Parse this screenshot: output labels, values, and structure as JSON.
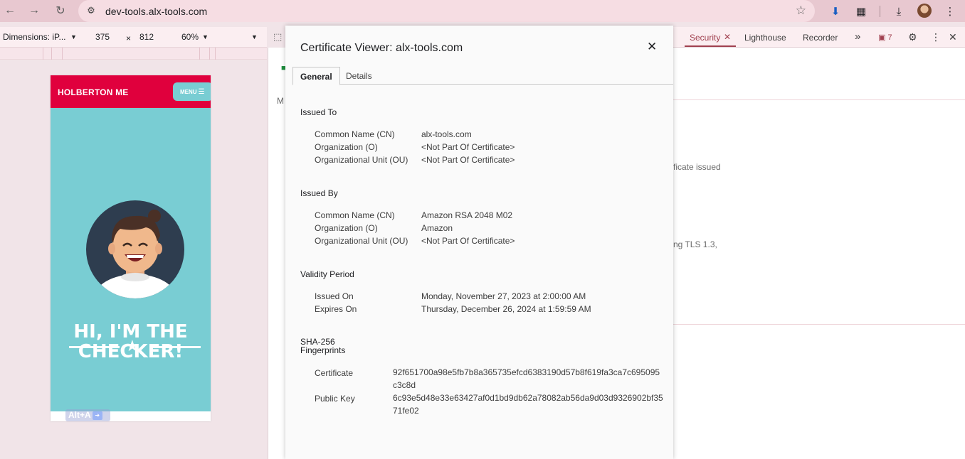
{
  "browser": {
    "url": "dev-tools.alx-tools.com",
    "back_icon": "arrow-left-icon",
    "forward_icon": "arrow-right-icon",
    "reload_icon": "reload-icon"
  },
  "device_toolbar": {
    "dimensions_label": "Dimensions: iP...",
    "width": "375",
    "times": "×",
    "height": "812",
    "zoom": "60%"
  },
  "website": {
    "brand": "HOLBERTON ME",
    "menu_label": "MENU",
    "hero_title_line1": "HI, I'M THE",
    "hero_title_line2": "CHECKER!",
    "alt_badge": "Alt+A"
  },
  "devtools": {
    "tabs": [
      "Security",
      "Lighthouse",
      "Recorder"
    ],
    "active_tab": "Security",
    "more_tabs": "»",
    "issues_count": "7",
    "left_partial_text": "M",
    "snippet_1": "ficate issued",
    "snippet_2": "ng TLS 1.3,"
  },
  "dialog": {
    "title": "Certificate Viewer: alx-tools.com",
    "tabs": [
      "General",
      "Details"
    ],
    "issued_to": {
      "heading": "Issued To",
      "rows": [
        {
          "label": "Common Name (CN)",
          "value": "alx-tools.com"
        },
        {
          "label": "Organization (O)",
          "value": "<Not Part Of Certificate>"
        },
        {
          "label": "Organizational Unit (OU)",
          "value": "<Not Part Of Certificate>"
        }
      ]
    },
    "issued_by": {
      "heading": "Issued By",
      "rows": [
        {
          "label": "Common Name (CN)",
          "value": "Amazon RSA 2048 M02"
        },
        {
          "label": "Organization (O)",
          "value": "Amazon"
        },
        {
          "label": "Organizational Unit (OU)",
          "value": "<Not Part Of Certificate>"
        }
      ]
    },
    "validity": {
      "heading": "Validity Period",
      "rows": [
        {
          "label": "Issued On",
          "value": "Monday, November 27, 2023 at 2:00:00 AM"
        },
        {
          "label": "Expires On",
          "value": "Thursday, December 26, 2024 at 1:59:59 AM"
        }
      ]
    },
    "fingerprints": {
      "heading_line1": "SHA-256",
      "heading_line2": "Fingerprints",
      "rows": [
        {
          "label": "Certificate",
          "value": "92f651700a98e5fb7b8a365735efcd6383190d57b8f619fa3ca7c695095c3c8d"
        },
        {
          "label": "Public Key",
          "value": "6c93e5d48e33e63427af0d1bd9db62a78082ab56da9d03d9326902bf3571fe02"
        }
      ]
    }
  },
  "colors": {
    "site_header": "#e0003d",
    "site_hero": "#79cdd3",
    "devtools_accent": "#a0404f"
  }
}
